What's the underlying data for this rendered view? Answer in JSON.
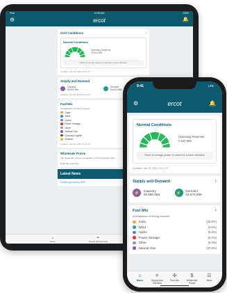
{
  "brand": {
    "logo": "ercot",
    "accent": "#0d5a6f",
    "link": "#2b8ec7"
  },
  "tablet": {
    "status": {
      "left": "iPad",
      "time": "10:30 AM",
      "battery": "100%"
    },
    "grid_conditions": {
      "title": "Grid Conditions",
      "normal_title": "Normal Conditions",
      "reserves_label": "Operating Reserves",
      "reserves_value": "10,000 MW",
      "message": "There is enough power to meet the current demand.",
      "updated": "Updated: Jan 28, 2020 11:21 CT"
    },
    "supply_demand": {
      "title": "Supply and Demand",
      "capacity_label": "Capacity",
      "capacity_value": "65,000 MW",
      "demand_label": "Demand",
      "demand_value": "55,000 MW",
      "updated": "Updated: Jan 28, 2020 11:21 CT"
    },
    "fuel_mix": {
      "title": "Fuel Mix",
      "desc": "A breakdown of energy sources.",
      "items": [
        "Solar",
        "Wind",
        "Hydro",
        "Power Storage",
        "Other",
        "Natural Gas",
        "Coal and Lignite",
        "Nuclear"
      ],
      "updated": "Updated: Jan 28, 2020 11:21 CT"
    },
    "wholesale": {
      "title": "Wholesale Prices",
      "desc": "The wholesale price per megawatt, not the consumer price.",
      "line": "Real-Time Hub Avg"
    },
    "news": {
      "title": "Latest News",
      "item": "Mobile app survey 2020"
    },
    "tabs": [
      "Home",
      "Supply and Demand",
      "Fuel Mix"
    ]
  },
  "phone": {
    "status": {
      "time": "9:41",
      "battery": "LTE"
    },
    "normal": {
      "title": "Normal Conditions",
      "reserves_label": "Operating Reserves",
      "reserves_value": "7,447 MW",
      "message": "There is enough power to meet the current demand.",
      "updated": "Updated: Jan 28, 2020 11:21 CT"
    },
    "supply_demand": {
      "title": "Supply and Demand",
      "capacity_label": "Capacity",
      "capacity_value": "65,880 MW",
      "demand_label": "Demand",
      "demand_value": "54,878 MW"
    },
    "fuel_mix": {
      "title": "Fuel Mix",
      "desc": "A breakdown of energy sources.",
      "items": [
        {
          "name": "Solar",
          "pct": "(32.6%)",
          "color": "#f2a33a"
        },
        {
          "name": "Wind",
          "pct": "(3.0%)",
          "color": "#3d8fcf"
        },
        {
          "name": "Hydro",
          "pct": "(0.0%)",
          "color": "#5e7fb8"
        },
        {
          "name": "Power Storage",
          "pct": "(0.0%)",
          "color": "#d33d3d"
        },
        {
          "name": "Other",
          "pct": "(0.0%)",
          "color": "#8f9aa3"
        },
        {
          "name": "Natural Gas",
          "pct": "(37.6%)",
          "color": "#8a5fb0"
        }
      ]
    },
    "tabs": [
      "Home",
      "Supply and Demand",
      "Fuel Mix",
      "Wholesale Prices",
      "More"
    ]
  }
}
